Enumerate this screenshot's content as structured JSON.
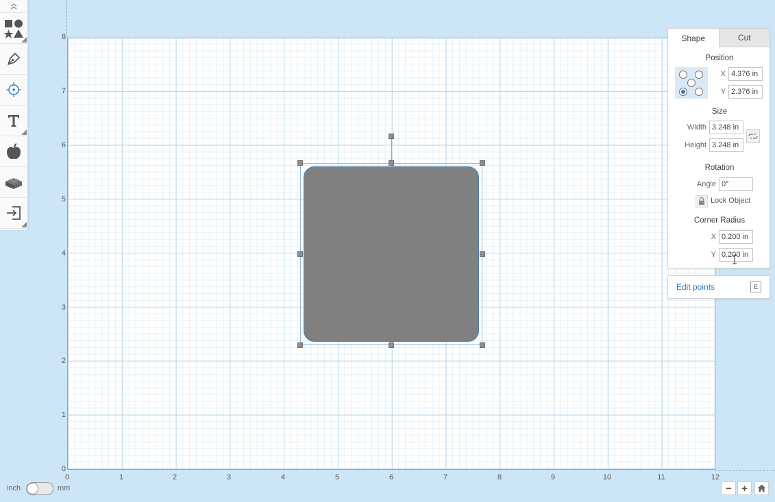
{
  "toolbar": {
    "tools": [
      {
        "name": "shapes-tool"
      },
      {
        "name": "pen-tool"
      },
      {
        "name": "target-tool"
      },
      {
        "name": "text-tool"
      },
      {
        "name": "image-tool"
      },
      {
        "name": "lego-tool"
      },
      {
        "name": "import-tool"
      }
    ]
  },
  "canvas": {
    "y_ticks": [
      "8",
      "7",
      "6",
      "5",
      "4",
      "3",
      "2",
      "1",
      "0"
    ],
    "x_ticks": [
      "0",
      "1",
      "2",
      "3",
      "4",
      "5",
      "6",
      "7",
      "8",
      "9",
      "10",
      "11",
      "12"
    ]
  },
  "panel": {
    "tab_shape": "Shape",
    "tab_cut": "Cut",
    "position_title": "Position",
    "x_label": "X",
    "x_value": "4.376 in",
    "y_label": "Y",
    "y_value": "2.376 in",
    "size_title": "Size",
    "width_label": "Width",
    "width_value": "3.248 in",
    "height_label": "Height",
    "height_value": "3.248 in",
    "rotation_title": "Rotation",
    "angle_label": "Angle",
    "angle_value": "0°",
    "lock_object_label": "Lock Object",
    "corner_radius_title": "Corner Radius",
    "cr_x_label": "X",
    "cr_x_value": "0.200 in",
    "cr_y_label": "Y",
    "cr_y_value": "0.200 in"
  },
  "edit_points": {
    "label": "Edit points",
    "shortcut": "E"
  },
  "units": {
    "left": "inch",
    "right": "mm"
  },
  "zoom": {
    "minus": "−",
    "plus": "+"
  },
  "colors": {
    "background": "#cde6f7",
    "shape_fill": "#808080",
    "accent": "#2f78c4"
  }
}
